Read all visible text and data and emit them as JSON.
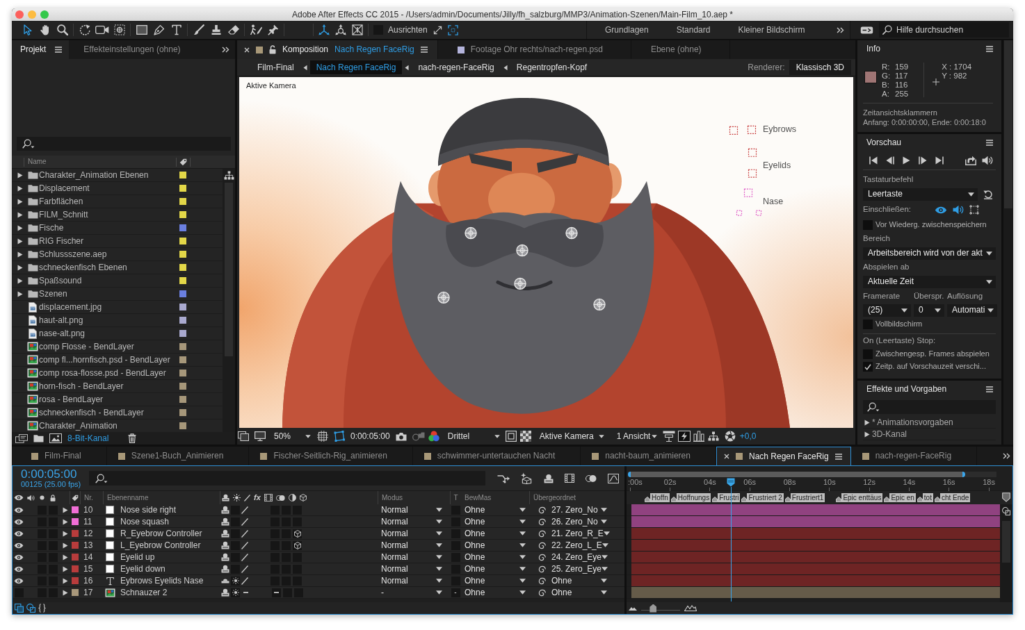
{
  "window": {
    "title": "Adobe After Effects CC 2015 - /Users/admin/Documents/Jilly/fh_salzburg/MMP3/Animation-Szenen/Main-Film_10.aep *"
  },
  "toolbar": {
    "tools": [
      {
        "kind": "selection",
        "selected": true
      },
      {
        "kind": "hand",
        "selected": false
      },
      {
        "kind": "zoom",
        "selected": false
      },
      {
        "kind": "rotation",
        "selected": false
      },
      {
        "kind": "camera",
        "selected": false
      },
      {
        "kind": "pan-behind",
        "selected": false
      },
      {
        "kind": "rectangle",
        "selected": false
      },
      {
        "kind": "pen",
        "selected": false
      },
      {
        "kind": "type",
        "selected": false
      },
      {
        "kind": "brush",
        "selected": false
      },
      {
        "kind": "clone-stamp",
        "selected": false
      },
      {
        "kind": "eraser",
        "selected": false
      },
      {
        "kind": "roto-brush",
        "selected": false
      },
      {
        "kind": "puppet-pin",
        "selected": false
      }
    ],
    "axis_modes": [
      {
        "kind": "local",
        "selected": true
      },
      {
        "kind": "world",
        "selected": false
      },
      {
        "kind": "view",
        "selected": false
      }
    ],
    "snap": {
      "label": "Ausrichten",
      "checked": false
    },
    "workspaces": [
      {
        "label": "Grundlagen",
        "selected": false
      },
      {
        "label": "Standard",
        "selected": false
      },
      {
        "label": "Kleiner Bildschirm",
        "selected": false
      }
    ],
    "help_search": {
      "placeholder": "Hilfe durchsuchen"
    }
  },
  "project": {
    "tabs": [
      {
        "label": "Projekt",
        "selected": true
      },
      {
        "label": "Effekteinstellungen (ohne)",
        "selected": false
      }
    ],
    "column": "Name",
    "items": [
      {
        "name": "Charakter_Animation Ebenen",
        "kind": "folder",
        "expanded": false,
        "color": "#e3d748"
      },
      {
        "name": "Displacement",
        "kind": "folder",
        "expanded": false,
        "color": "#e3d748"
      },
      {
        "name": "Farbflächen",
        "kind": "folder",
        "expanded": false,
        "color": "#e3d748"
      },
      {
        "name": "FILM_Schnitt",
        "kind": "folder",
        "expanded": false,
        "color": "#e3d748"
      },
      {
        "name": "Fische",
        "kind": "folder",
        "expanded": false,
        "color": "#6a7fe0"
      },
      {
        "name": "RIG Fischer",
        "kind": "folder",
        "expanded": false,
        "color": "#e3d748"
      },
      {
        "name": "Schlussszene.aep",
        "kind": "folder",
        "expanded": false,
        "color": "#e3d748"
      },
      {
        "name": "schneckenfisch Ebenen",
        "kind": "folder",
        "expanded": false,
        "color": "#e3d748"
      },
      {
        "name": "Spaßsound",
        "kind": "folder",
        "expanded": false,
        "color": "#e3d748"
      },
      {
        "name": "Szenen",
        "kind": "folder",
        "expanded": false,
        "color": "#6a7fe0"
      },
      {
        "name": "displacement.jpg",
        "kind": "file",
        "color": "#a9a9cf"
      },
      {
        "name": "haut-alt.png",
        "kind": "file",
        "color": "#a9a9cf"
      },
      {
        "name": "nase-alt.png",
        "kind": "file",
        "color": "#a9a9cf"
      },
      {
        "name": "comp Flosse - BendLayer",
        "kind": "comp",
        "color": "#a6977a"
      },
      {
        "name": "comp fl...hornfisch.psd - BendLayer",
        "kind": "comp",
        "color": "#a6977a"
      },
      {
        "name": "comp rosa-flosse.psd - BendLayer",
        "kind": "comp",
        "color": "#a6977a"
      },
      {
        "name": "horn-fisch - BendLayer",
        "kind": "comp",
        "color": "#a6977a"
      },
      {
        "name": "rosa - BendLayer",
        "kind": "comp",
        "color": "#a6977a"
      },
      {
        "name": "schneckenfisch - BendLayer",
        "kind": "comp",
        "color": "#a6977a"
      },
      {
        "name": "Charakter_Animation",
        "kind": "comp",
        "color": "#a6977a"
      }
    ],
    "bit_depth": "8-Bit-Kanal"
  },
  "composition": {
    "tabs": [
      {
        "prefix": "Komposition",
        "label": "Nach Regen FaceRig",
        "selected": true,
        "color": "#a89878",
        "locked": false
      },
      {
        "label": "Footage Ohr rechts/nach-regen.psd",
        "selected": false,
        "color": "#b4b4dc"
      },
      {
        "label": "Ebene (ohne)",
        "selected": false
      }
    ],
    "breadcrumbs": [
      {
        "label": "Film-Final",
        "selected": false
      },
      {
        "label": "Nach Regen FaceRig",
        "selected": true
      },
      {
        "label": "nach-regen-FaceRig",
        "selected": false
      },
      {
        "label": "Regentropfen-Kopf",
        "selected": false
      }
    ],
    "renderer": {
      "label": "Renderer:",
      "value": "Klassisch 3D"
    },
    "viewer": {
      "camera_label": "Aktive Kamera",
      "text_layer_lines": [
        "Eybrows",
        "Eyelids",
        "Nase"
      ]
    },
    "viewer_bar": {
      "zoom": "50%",
      "timecode": "0:00:05:00",
      "resolution": "Drittel",
      "view": "Aktive Kamera",
      "layout": "1 Ansicht",
      "exposure": "+0,0"
    }
  },
  "info": {
    "title": "Info",
    "swatch": {
      "color": "#9f7574"
    },
    "channels": [
      {
        "label": "R:",
        "value": "159"
      },
      {
        "label": "G:",
        "value": "117"
      },
      {
        "label": "B:",
        "value": "116"
      },
      {
        "label": "A:",
        "value": "255"
      }
    ],
    "coordinates": [
      "X : 1704",
      "Y : 982"
    ],
    "brackets_title": "Zeitansichtsklammern",
    "brackets_range": "Anfang: 0:00:00:00, Ende: 0:00:18:0"
  },
  "preview": {
    "title": "Vorschau",
    "shortcut_label": "Tastaturbefehl",
    "shortcut": "Leertaste",
    "include_label": "Einschließen:",
    "include": [
      {
        "kind": "video",
        "on": true
      },
      {
        "kind": "audio",
        "on": true
      },
      {
        "kind": "overlays",
        "on": false
      }
    ],
    "cache_option": {
      "label": "Vor Wiederg. zwischenspeichern",
      "checked": false
    },
    "range_label": "Bereich",
    "range": "Arbeitsbereich wird von der akt",
    "play_from_label": "Abspielen ab",
    "play_from": "Aktuelle Zeit",
    "settings": [
      {
        "label": "Framerate",
        "value": "(25)"
      },
      {
        "label": "Überspr.",
        "value": "0"
      },
      {
        "label": "Auflösung",
        "value": "Automati"
      }
    ],
    "fullscreen": {
      "label": "Vollbildschirm",
      "checked": false
    },
    "stop_label": "On (Leertaste) Stop:",
    "stop_options": [
      {
        "label": "Zwischengesp. Frames abspielen",
        "checked": false
      },
      {
        "label": "Zeitp. auf Vorschauzeit verschi...",
        "checked": true
      }
    ]
  },
  "effects": {
    "title": "Effekte und Vorgaben",
    "items": [
      {
        "label": "* Animationsvorgaben",
        "expanded": false
      },
      {
        "label": "3D-Kanal",
        "expanded": false
      }
    ]
  },
  "timeline": {
    "tabs": [
      {
        "label": "Film-Final",
        "selected": false
      },
      {
        "label": "Szene1-Buch_Animieren",
        "selected": false
      },
      {
        "label": "Fischer-Seitlich-Rig_animieren",
        "selected": false
      },
      {
        "label": "schwimmer-untertauchen Nacht",
        "selected": false
      },
      {
        "label": "nacht-baum_animieren",
        "selected": false
      },
      {
        "label": "Nach Regen FaceRig",
        "selected": true
      },
      {
        "label": "nach-regen-FaceRig",
        "selected": false
      }
    ],
    "timecode": "0:00:05:00",
    "frame_info": "00125 (25.00 fps)",
    "columns": {
      "number": "Nr.",
      "name": "Ebenenname",
      "effects": "fx",
      "mode": "Modus",
      "preserve": "T",
      "track_matte": "BewMas",
      "parent": "Übergeordnet"
    },
    "layers": [
      {
        "number": "10",
        "name": "Nose side right",
        "kind": "solid",
        "color": "#f06ed6",
        "visible": true,
        "solo": false,
        "locked": false,
        "expanded": false,
        "three_d": false,
        "mode": "Normal",
        "preserve_transparency": false,
        "track_matte": "Ohne",
        "parent": "27. Zero_No"
      },
      {
        "number": "11",
        "name": "Nose squash",
        "kind": "solid",
        "color": "#f06ed6",
        "visible": true,
        "solo": false,
        "locked": false,
        "expanded": false,
        "three_d": false,
        "mode": "Normal",
        "preserve_transparency": false,
        "track_matte": "Ohne",
        "parent": "26. Zero_No"
      },
      {
        "number": "12",
        "name": "R_Eyebrow Controller",
        "kind": "solid",
        "color": "#b83c3c",
        "visible": true,
        "solo": false,
        "locked": false,
        "expanded": false,
        "three_d": true,
        "mode": "Normal",
        "preserve_transparency": false,
        "track_matte": "Ohne",
        "parent": "21. Zero_R_E"
      },
      {
        "number": "13",
        "name": "L_Eyebrow Controller",
        "kind": "solid",
        "color": "#b83c3c",
        "visible": true,
        "solo": false,
        "locked": false,
        "expanded": false,
        "three_d": true,
        "mode": "Normal",
        "preserve_transparency": false,
        "track_matte": "Ohne",
        "parent": "22. Zero_L_E"
      },
      {
        "number": "14",
        "name": "Eyelid up",
        "kind": "solid",
        "color": "#b83c3c",
        "visible": true,
        "solo": false,
        "locked": false,
        "expanded": false,
        "three_d": false,
        "mode": "Normal",
        "preserve_transparency": false,
        "track_matte": "Ohne",
        "parent": "24. Zero_Eye"
      },
      {
        "number": "15",
        "name": "Eyelid down",
        "kind": "solid",
        "color": "#b83c3c",
        "visible": true,
        "solo": false,
        "locked": false,
        "expanded": false,
        "three_d": false,
        "mode": "Normal",
        "preserve_transparency": false,
        "track_matte": "Ohne",
        "parent": "25. Zero_Eye"
      },
      {
        "number": "16",
        "name": "Eybrows Eyelids Nase",
        "kind": "text",
        "color": "#b83c3c",
        "visible": true,
        "solo": false,
        "locked": false,
        "expanded": false,
        "three_d": false,
        "mode": "Normal",
        "preserve_transparency": false,
        "track_matte": "Ohne",
        "parent": "Ohne"
      },
      {
        "number": "17",
        "name": "Schnauzer 2",
        "kind": "comp",
        "color": "#a8977a",
        "visible": false,
        "solo": false,
        "locked": false,
        "expanded": false,
        "three_d": false,
        "mode": "-",
        "preserve": "-",
        "preserve_transparency": false,
        "track_matte": "Ohne",
        "parent": "Ohne"
      }
    ],
    "ruler": [
      ":00s",
      "02s",
      "04s",
      "06s",
      "08s",
      "10s",
      "12s",
      "14s",
      "16s",
      "18s"
    ],
    "markers": [
      "Hoffn",
      "Hoffnungs",
      "Frustri",
      "Frustriert 2",
      "Frustriert1",
      "Epic enttäus",
      "Epic en",
      "tot",
      "cht Ende"
    ],
    "work_area": {
      "level": 0.915
    },
    "playhead": {
      "level": 0.274
    },
    "zoom": {
      "level": 0.31
    }
  }
}
